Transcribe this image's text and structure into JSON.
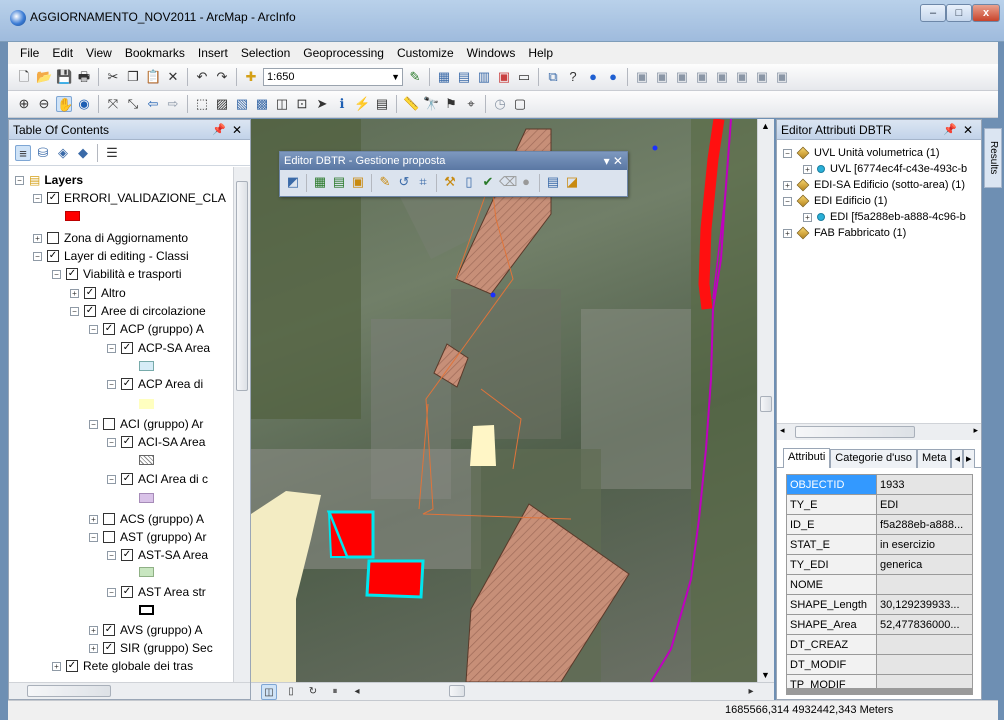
{
  "window": {
    "title": "AGGIORNAMENTO_NOV2011 - ArcMap - ArcInfo",
    "minimize": "–",
    "maximize": "□",
    "close": "x"
  },
  "menu": [
    "File",
    "Edit",
    "View",
    "Bookmarks",
    "Insert",
    "Selection",
    "Geoprocessing",
    "Customize",
    "Windows",
    "Help"
  ],
  "toolbar": {
    "scale": "1:650"
  },
  "toc": {
    "title": "Table Of Contents",
    "items": [
      {
        "label": "Layers",
        "expander": "−",
        "checked": null
      },
      {
        "label": "ERRORI_VALIDAZIONE_CLA",
        "expander": "−",
        "checked": true
      },
      {
        "label": "Zona di Aggiornamento",
        "expander": "+",
        "checked": false
      },
      {
        "label": "Layer di editing - Classi",
        "expander": "−",
        "checked": true
      },
      {
        "label": "Viabilità e trasporti",
        "expander": "−",
        "checked": true
      },
      {
        "label": "Altro",
        "expander": "+",
        "checked": true
      },
      {
        "label": "Aree di circolazione",
        "expander": "−",
        "checked": true
      },
      {
        "label": "ACP (gruppo) A",
        "expander": "−",
        "checked": true
      },
      {
        "label": "ACP-SA Area",
        "expander": "−",
        "checked": true
      },
      {
        "label": "ACP Area di",
        "expander": "−",
        "checked": true
      },
      {
        "label": "ACI (gruppo) Ar",
        "expander": "−",
        "checked": false
      },
      {
        "label": "ACI-SA Area",
        "expander": "−",
        "checked": true
      },
      {
        "label": "ACI Area di c",
        "expander": "−",
        "checked": true
      },
      {
        "label": "ACS (gruppo) A",
        "expander": "+",
        "checked": false
      },
      {
        "label": "AST (gruppo) Ar",
        "expander": "−",
        "checked": false
      },
      {
        "label": "AST-SA Area",
        "expander": "−",
        "checked": true
      },
      {
        "label": "AST Area str",
        "expander": "−",
        "checked": true
      },
      {
        "label": "AVS (gruppo) A",
        "expander": "+",
        "checked": true
      },
      {
        "label": "SIR (gruppo) Sec",
        "expander": "+",
        "checked": true
      },
      {
        "label": "Rete globale dei tras",
        "expander": "+",
        "checked": true
      }
    ],
    "swatch_colors": {
      "errori": "#ff0000",
      "acp_sa": "#d6ecf7",
      "acp": "#ffffc0",
      "aci": "#d9c2e8",
      "ast_sa": "#c8e6c0",
      "ast": "#ffffff"
    }
  },
  "float_toolbar": {
    "title": "Editor DBTR - Gestione proposta"
  },
  "right_panel": {
    "title": "Editor Attributi DBTR",
    "results_tab": "Results",
    "tree": [
      {
        "label": "UVL Unità volumetrica (1)",
        "expander": "−",
        "kind": "diamond"
      },
      {
        "label": "UVL [6774ec4f-c43e-493c-b",
        "expander": "+",
        "kind": "dot"
      },
      {
        "label": "EDI-SA Edificio (sotto-area) (1)",
        "expander": "+",
        "kind": "diamond"
      },
      {
        "label": "EDI Edificio (1)",
        "expander": "−",
        "kind": "diamond"
      },
      {
        "label": "EDI [f5a288eb-a888-4c96-b",
        "expander": "+",
        "kind": "dot"
      },
      {
        "label": "FAB Fabbricato (1)",
        "expander": "+",
        "kind": "diamond"
      }
    ],
    "tabs": [
      "Attributi",
      "Categorie d'uso",
      "Meta"
    ],
    "attributes": [
      {
        "key": "OBJECTID",
        "value": "1933"
      },
      {
        "key": "TY_E",
        "value": "EDI"
      },
      {
        "key": "ID_E",
        "value": "f5a288eb-a888..."
      },
      {
        "key": "STAT_E",
        "value": "in esercizio"
      },
      {
        "key": "TY_EDI",
        "value": "generica"
      },
      {
        "key": "NOME",
        "value": ""
      },
      {
        "key": "SHAPE_Length",
        "value": "30,129239933..."
      },
      {
        "key": "SHAPE_Area",
        "value": "52,477836000..."
      },
      {
        "key": "DT_CREAZ",
        "value": ""
      },
      {
        "key": "DT_MODIF",
        "value": ""
      },
      {
        "key": "TP_MODIF",
        "value": ""
      }
    ]
  },
  "status": {
    "coordinates": "1685566,314  4932442,343 Meters"
  }
}
